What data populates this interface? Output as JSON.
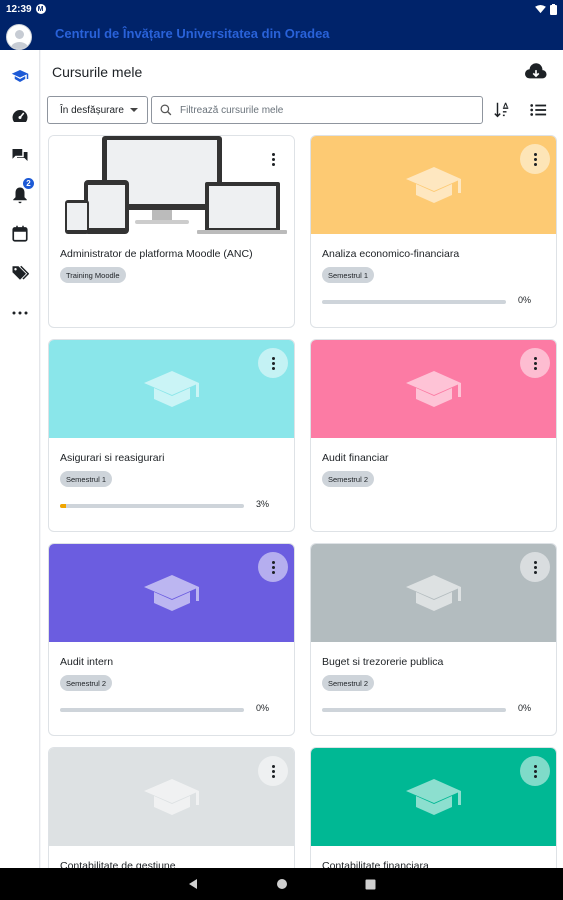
{
  "status_bar": {
    "time": "12:39",
    "app_badge": "M"
  },
  "header": {
    "site_title": "Centrul de Învățare Universitatea din Oradea"
  },
  "rail": {
    "notifications_badge": "2"
  },
  "page": {
    "title": "Cursurile mele",
    "filter_value": "În desfășurare",
    "search_placeholder": "Filtrează cursurile mele"
  },
  "courses": [
    {
      "name": "Administrator de platforma Moodle (ANC)",
      "category": "Training Moodle",
      "cover_color": "#ffffff",
      "cover": "devices",
      "progress": null,
      "menu_bg": "transparent"
    },
    {
      "name": "Analiza economico-financiara",
      "category": "Semestrul 1",
      "cover_color": "#fdca73",
      "cover": "cap",
      "progress": 0,
      "progress_label": "0%",
      "menu_bg": "#fde5b7"
    },
    {
      "name": "Asigurari si reasigurari",
      "category": "Semestrul 1",
      "cover_color": "#8ae6ea",
      "cover": "cap",
      "progress": 0.03,
      "progress_label": "3%",
      "menu_bg": "#c4f2f4"
    },
    {
      "name": "Audit financiar",
      "category": "Semestrul 2",
      "cover_color": "#fc7ba4",
      "cover": "cap",
      "progress": null,
      "menu_bg": "#fdbdd1"
    },
    {
      "name": "Audit intern",
      "category": "Semestrul 2",
      "cover_color": "#6b5de0",
      "cover": "cap",
      "progress": 0,
      "progress_label": "0%",
      "menu_bg": "#b5aeef"
    },
    {
      "name": "Buget si trezorerie publica",
      "category": "Semestrul 2",
      "cover_color": "#b3bcbf",
      "cover": "cap",
      "progress": 0,
      "progress_label": "0%",
      "menu_bg": "#d9dddf"
    },
    {
      "name": "Contabilitate de gestiune",
      "category": "",
      "cover_color": "#dde1e3",
      "cover": "cap",
      "progress": null,
      "menu_bg": "#eef0f1"
    },
    {
      "name": "Contabilitate financiara",
      "category": "",
      "cover_color": "#00b894",
      "cover": "cap",
      "progress": null,
      "menu_bg": "#7fdbc9"
    }
  ],
  "colors": {
    "header_bg": "#00236a",
    "accent": "#1d5ad6",
    "progress": "#f0a500"
  },
  "icons": [
    "user-avatar-icon",
    "mortarboard-icon",
    "dashboard-icon",
    "chat-icon",
    "bell-icon",
    "calendar-icon",
    "tags-icon",
    "more-icon",
    "cloud-download-icon",
    "search-icon",
    "sort-icon",
    "list-view-icon"
  ]
}
